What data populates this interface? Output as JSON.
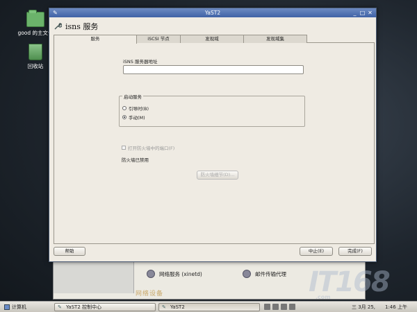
{
  "desktop": {
    "icons": [
      {
        "label": "good 的主文件",
        "icon": "folder-icon"
      },
      {
        "label": "回收站",
        "icon": "trash-icon"
      }
    ]
  },
  "window": {
    "title": "YaST2",
    "header": "isns 服务",
    "tabs": [
      "服务",
      "iSCSI 节点",
      "发现域",
      "发现域集"
    ],
    "active_tab": 0,
    "service": {
      "address_label": "iSNS 服务器地址",
      "address_value": "",
      "startup_group_label": "启动服务",
      "options": [
        {
          "label": "引导时(B)",
          "selected": false
        },
        {
          "label": "手动(M)",
          "selected": true
        }
      ],
      "firewall_checkbox_label": "打开防火墙中的端口(F)",
      "firewall_checkbox_checked": false,
      "firewall_details_button": "防火墙细节(D)...",
      "firewall_status": "防火墙已禁用"
    },
    "buttons": {
      "help": "帮助",
      "cancel": "中止(E)",
      "finish": "完成(F)"
    }
  },
  "background_window": {
    "items": [
      {
        "label": "网络服务 (xinetd)",
        "icon": "network-services-icon"
      },
      {
        "label": "邮件传输代理",
        "icon": "mail-transfer-agent-icon"
      }
    ],
    "section_title": "网络设备"
  },
  "taskbar": {
    "start_label": "计算机",
    "tasks": [
      {
        "label": "YaST2 控制中心",
        "active": false
      },
      {
        "label": "YaST2",
        "active": true
      }
    ],
    "tray_icons": [
      "network-icon",
      "keyboard-icon",
      "battery-icon",
      "volume-icon"
    ],
    "date": "三 3月 25,",
    "time": "1:46 上午"
  },
  "watermark": {
    "text": "IT168",
    "sub": ".com"
  }
}
